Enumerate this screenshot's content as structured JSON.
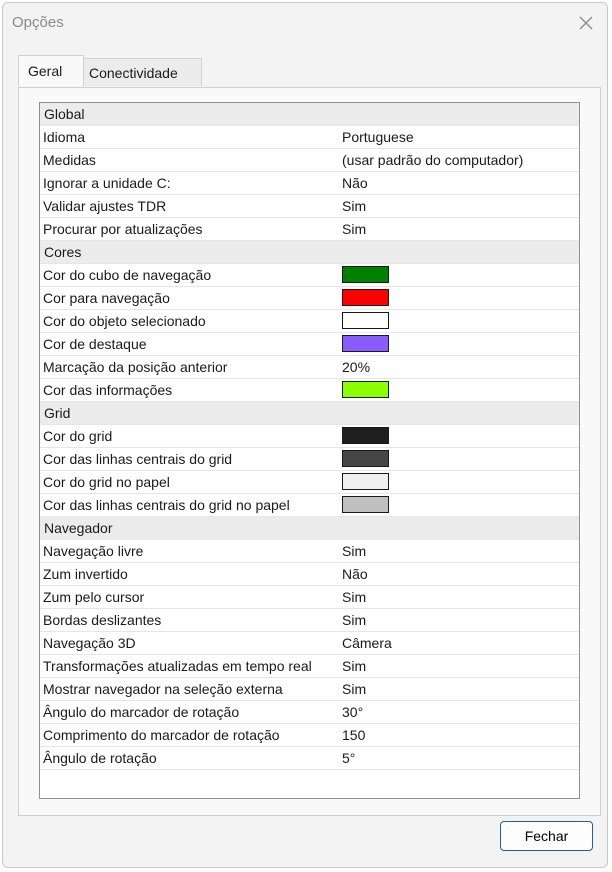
{
  "window": {
    "title": "Opções",
    "close_icon": "close-icon"
  },
  "tabs": [
    {
      "label": "Geral",
      "selected": true
    },
    {
      "label": "Conectividade",
      "selected": false
    }
  ],
  "properties": [
    {
      "type": "section",
      "label": "Global"
    },
    {
      "type": "text",
      "label": "Idioma",
      "value": "Portuguese"
    },
    {
      "type": "text",
      "label": "Medidas",
      "value": "(usar padrão do computador)"
    },
    {
      "type": "text",
      "label": "Ignorar a unidade C:",
      "value": "Não"
    },
    {
      "type": "text",
      "label": "Validar ajustes TDR",
      "value": "Sim"
    },
    {
      "type": "text",
      "label": "Procurar por atualizações",
      "value": "Sim"
    },
    {
      "type": "section",
      "label": "Cores"
    },
    {
      "type": "color",
      "label": "Cor do cubo de navegação",
      "color": "#008000"
    },
    {
      "type": "color",
      "label": "Cor para navegação",
      "color": "#ff0000"
    },
    {
      "type": "color",
      "label": "Cor do objeto selecionado",
      "color": "#ffffff"
    },
    {
      "type": "color",
      "label": "Cor de destaque",
      "color": "#8a5cff"
    },
    {
      "type": "text",
      "label": "Marcação da posição anterior",
      "value": "20%"
    },
    {
      "type": "color",
      "label": "Cor das informações",
      "color": "#8cff00"
    },
    {
      "type": "section",
      "label": "Grid"
    },
    {
      "type": "color",
      "label": "Cor do grid",
      "color": "#1e1e1e"
    },
    {
      "type": "color",
      "label": "Cor das linhas centrais do grid",
      "color": "#464646"
    },
    {
      "type": "color",
      "label": "Cor do grid no papel",
      "color": "#f0f0f0"
    },
    {
      "type": "color",
      "label": "Cor das linhas centrais do grid no papel",
      "color": "#c0c0c0"
    },
    {
      "type": "section",
      "label": "Navegador"
    },
    {
      "type": "text",
      "label": "Navegação livre",
      "value": "Sim"
    },
    {
      "type": "text",
      "label": "Zum invertido",
      "value": "Não"
    },
    {
      "type": "text",
      "label": "Zum pelo cursor",
      "value": "Sim"
    },
    {
      "type": "text",
      "label": "Bordas deslizantes",
      "value": "Sim"
    },
    {
      "type": "text",
      "label": "Navegação 3D",
      "value": "Câmera"
    },
    {
      "type": "text",
      "label": "Transformações atualizadas em tempo real",
      "value": "Sim"
    },
    {
      "type": "text",
      "label": "Mostrar navegador na seleção externa",
      "value": "Sim"
    },
    {
      "type": "text",
      "label": "Ângulo do marcador de rotação",
      "value": "30°"
    },
    {
      "type": "text",
      "label": "Comprimento do marcador de rotação",
      "value": "150"
    },
    {
      "type": "text",
      "label": "Ângulo de rotação",
      "value": "5°"
    }
  ],
  "footer": {
    "close_label": "Fechar"
  }
}
